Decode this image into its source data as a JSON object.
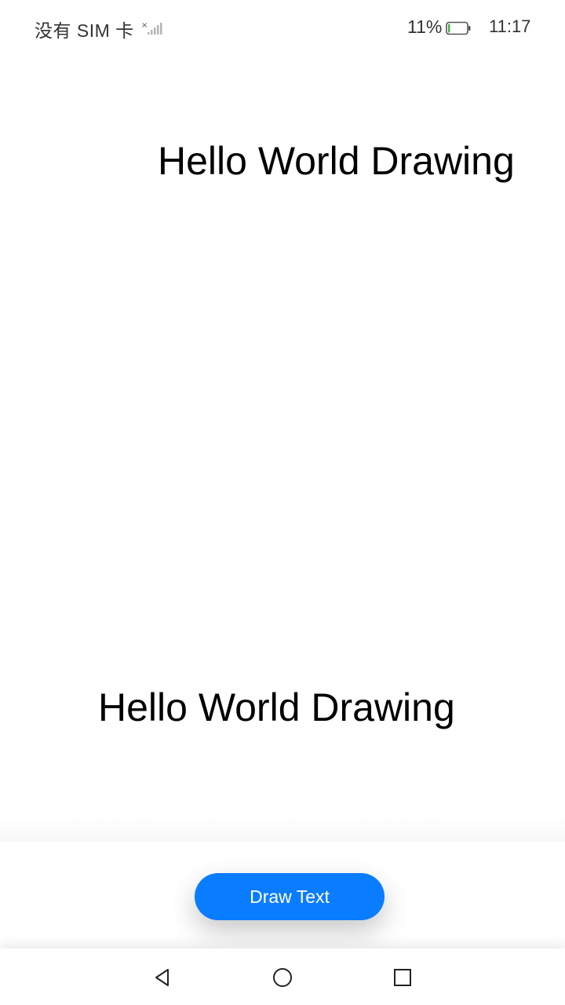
{
  "status_bar": {
    "carrier": "没有 SIM 卡",
    "signal_icon": "signal-no-sim-icon",
    "battery_percent": "11%",
    "battery_icon": "battery-low-icon",
    "battery_level": 0.11,
    "battery_color": "#4CAF50",
    "time": "11:17"
  },
  "canvas": {
    "texts": [
      "Hello World Drawing",
      "Hello World Drawing"
    ]
  },
  "controls": {
    "draw_button_label": "Draw Text",
    "draw_button_color": "#0A7CFF"
  },
  "nav_bar": {
    "back_icon": "back-triangle-icon",
    "home_icon": "home-circle-icon",
    "recent_icon": "recent-square-icon"
  }
}
